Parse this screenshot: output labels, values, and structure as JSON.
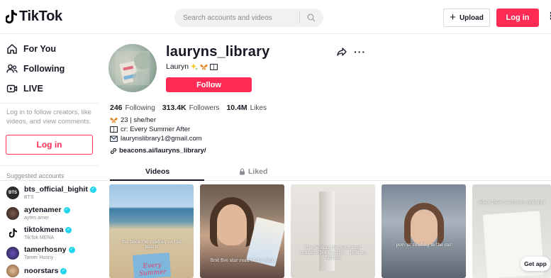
{
  "header": {
    "logo_text": "TikTok",
    "search_placeholder": "Search accounts and videos",
    "upload_label": "Upload",
    "login_label": "Log in"
  },
  "sidebar": {
    "nav": [
      {
        "label": "For You",
        "icon": "home-icon"
      },
      {
        "label": "Following",
        "icon": "following-icon"
      },
      {
        "label": "LIVE",
        "icon": "live-icon"
      }
    ],
    "login_prompt": "Log in to follow creators, like videos, and view comments.",
    "login_label": "Log in",
    "suggested_title": "Suggested accounts",
    "suggested": [
      {
        "username": "bts_official_bighit",
        "display": "BTS",
        "avatar_text": "BTS",
        "avatar_color": "#2b2b2b"
      },
      {
        "username": "aytenamer",
        "display": "ayten amer",
        "avatar_text": "",
        "avatar_color": "#3a2e2a"
      },
      {
        "username": "tiktokmena",
        "display": "TikTok MENA",
        "avatar_text": "",
        "avatar_color": "#ffffff"
      },
      {
        "username": "tamerhosny",
        "display": "Tamer Hosny",
        "avatar_text": "",
        "avatar_color": "#1c2340"
      },
      {
        "username": "noorstars",
        "display": "",
        "avatar_text": "",
        "avatar_color": "#c9a07a"
      }
    ]
  },
  "profile": {
    "username": "lauryns_library",
    "nickname": "Lauryn",
    "follow_label": "Follow",
    "stats": [
      {
        "value": "246",
        "label": "Following"
      },
      {
        "value": "313.4K",
        "label": "Followers"
      },
      {
        "value": "10.4M",
        "label": "Likes"
      }
    ],
    "bio": [
      "23 | she/her",
      "cr: Every Summer After",
      "laurynslibrary1@gmail.com"
    ],
    "link": "beacons.ai/lauryns_library/"
  },
  "tabs": {
    "videos": "Videos",
    "liked": "Liked"
  },
  "videos": [
    {
      "caption": "the book i'm reading on the beach",
      "caption2": "Every Summer"
    },
    {
      "caption": "first five star read of the year",
      "caption2": ""
    },
    {
      "caption": "if ur looking for your next romance book series... look no further",
      "caption2": ""
    },
    {
      "caption": "pov: ur reading in the car",
      "caption2": ""
    },
    {
      "caption": "when there's a bonus epilogue",
      "caption2": ""
    }
  ],
  "get_app": "Get app",
  "colors": {
    "brand_red": "#fe2c55",
    "verified": "#20d5ec"
  }
}
